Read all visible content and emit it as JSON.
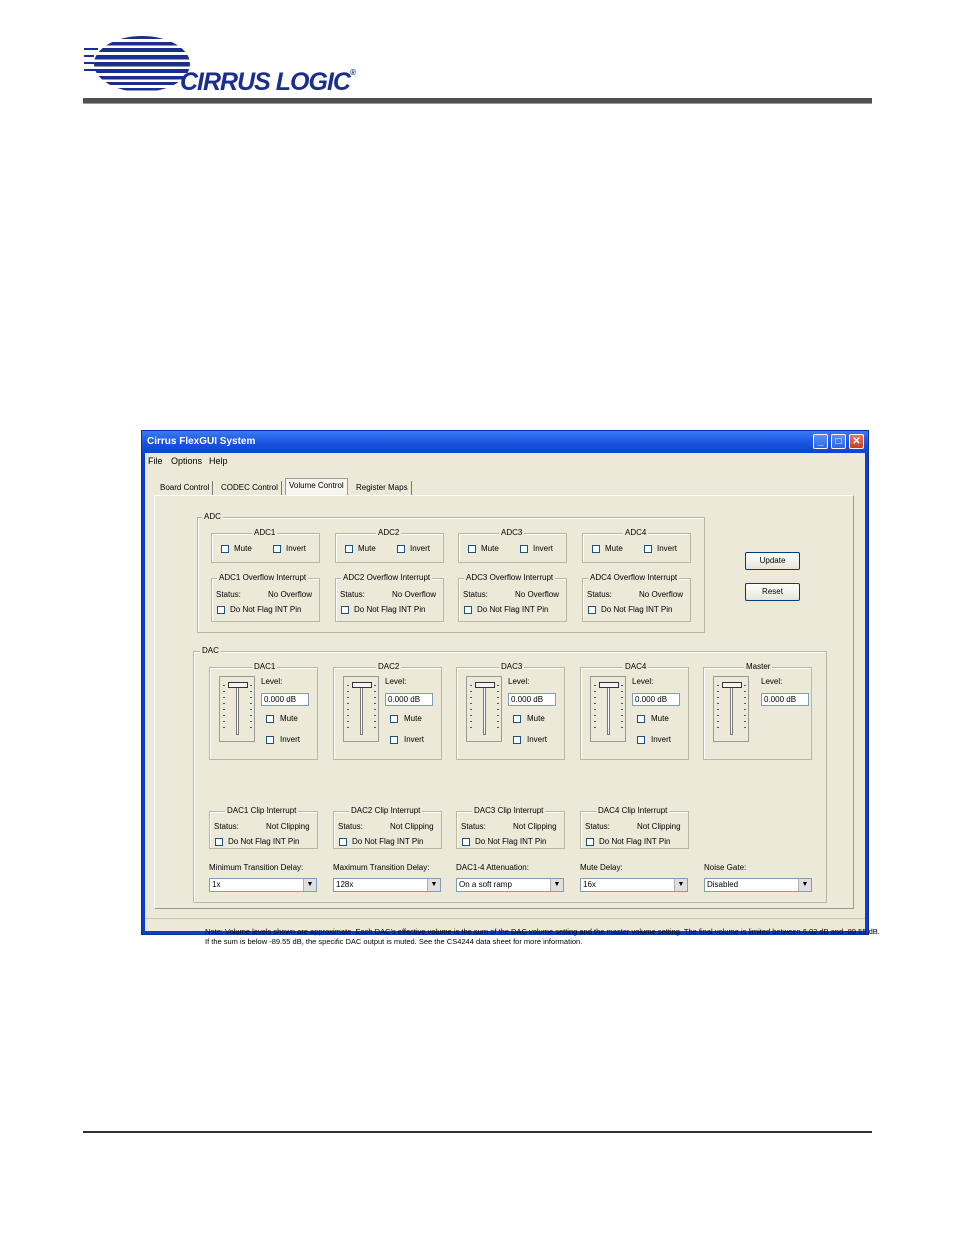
{
  "header": {
    "logo_text": "CIRRUS LOGIC",
    "logo_mark": "®"
  },
  "window": {
    "title": "Cirrus FlexGUI System",
    "menu": [
      "File",
      "Options",
      "Help"
    ],
    "tabs": [
      "Board Control",
      "CODEC Control",
      "Volume Control",
      "Register Maps"
    ],
    "active_tab": "Volume Control"
  },
  "adc": {
    "group_label": "ADC",
    "channels": [
      {
        "name": "ADC1",
        "mute": "Mute",
        "invert": "Invert",
        "interrupt_title": "ADC1 Overflow Interrupt",
        "status_label": "Status:",
        "status_value": "No Overflow",
        "flag_label": "Do Not Flag INT Pin"
      },
      {
        "name": "ADC2",
        "mute": "Mute",
        "invert": "Invert",
        "interrupt_title": "ADC2 Overflow Interrupt",
        "status_label": "Status:",
        "status_value": "No Overflow",
        "flag_label": "Do Not Flag INT Pin"
      },
      {
        "name": "ADC3",
        "mute": "Mute",
        "invert": "Invert",
        "interrupt_title": "ADC3 Overflow Interrupt",
        "status_label": "Status:",
        "status_value": "No Overflow",
        "flag_label": "Do Not Flag INT Pin"
      },
      {
        "name": "ADC4",
        "mute": "Mute",
        "invert": "Invert",
        "interrupt_title": "ADC4 Overflow Interrupt",
        "status_label": "Status:",
        "status_value": "No Overflow",
        "flag_label": "Do Not Flag INT Pin"
      }
    ]
  },
  "buttons": {
    "update": "Update",
    "reset": "Reset"
  },
  "dac": {
    "group_label": "DAC",
    "channels": [
      {
        "name": "DAC1",
        "level_label": "Level:",
        "level_value": "0.000 dB",
        "mute": "Mute",
        "invert": "Invert",
        "interrupt_title": "DAC1 Clip Interrupt",
        "status_label": "Status:",
        "status_value": "Not Clipping",
        "flag_label": "Do Not Flag INT Pin"
      },
      {
        "name": "DAC2",
        "level_label": "Level:",
        "level_value": "0.000 dB",
        "mute": "Mute",
        "invert": "Invert",
        "interrupt_title": "DAC2 Clip Interrupt",
        "status_label": "Status:",
        "status_value": "Not Clipping",
        "flag_label": "Do Not Flag INT Pin"
      },
      {
        "name": "DAC3",
        "level_label": "Level:",
        "level_value": "0.000 dB",
        "mute": "Mute",
        "invert": "Invert",
        "interrupt_title": "DAC3 Clip Interrupt",
        "status_label": "Status:",
        "status_value": "Not Clipping",
        "flag_label": "Do Not Flag INT Pin"
      },
      {
        "name": "DAC4",
        "level_label": "Level:",
        "level_value": "0.000 dB",
        "mute": "Mute",
        "invert": "Invert",
        "interrupt_title": "DAC4 Clip Interrupt",
        "status_label": "Status:",
        "status_value": "Not Clipping",
        "flag_label": "Do Not Flag INT Pin"
      }
    ],
    "master": {
      "name": "Master",
      "level_label": "Level:",
      "level_value": "0.000 dB"
    },
    "note": "Note: Volume levels shown are approximate. Each DAC's effective volume is the sum of the DAC volume setting and the master volume setting. The final volume is limited between 6.02 dB and -89.55 dB. If the sum is below -89.55 dB, the specific DAC output is muted. See the CS4244 data sheet for more information.",
    "selects": [
      {
        "label": "Minimum Transition Delay:",
        "value": "1x"
      },
      {
        "label": "Maximum Transition Delay:",
        "value": "128x"
      },
      {
        "label": "DAC1-4 Attenuation:",
        "value": "On a soft ramp"
      },
      {
        "label": "Mute Delay:",
        "value": "16x"
      },
      {
        "label": "Noise Gate:",
        "value": "Disabled"
      }
    ]
  }
}
